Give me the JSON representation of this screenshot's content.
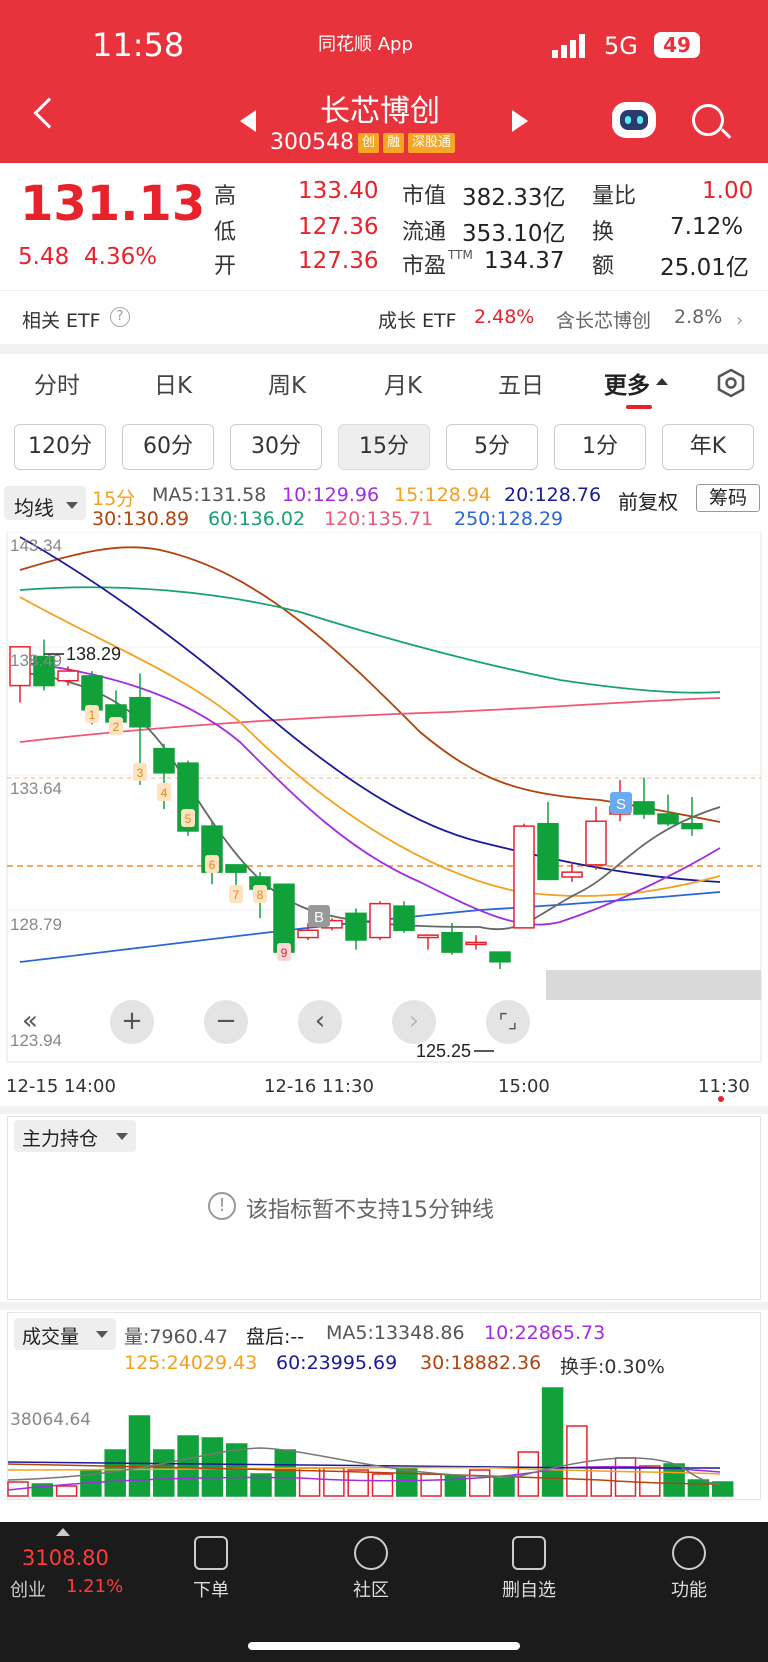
{
  "status": {
    "time": "11:58",
    "app": "同花顺 App",
    "network": "5G",
    "battery": "49"
  },
  "header": {
    "name": "长芯博创",
    "code": "300548",
    "tags": [
      "创",
      "融",
      "深股通"
    ]
  },
  "quote": {
    "price": "131.13",
    "change": "5.48",
    "pct": "4.36%",
    "high_label": "高",
    "high": "133.40",
    "low_label": "低",
    "low": "127.36",
    "open_label": "开",
    "open": "127.36",
    "mcap_label": "市值",
    "mcap": "382.33亿",
    "float_label": "流通",
    "float": "353.10亿",
    "pe_label": "市盈",
    "pe_sup": "TTM",
    "pe": "134.37",
    "volratio_label": "量比",
    "volratio": "1.00",
    "turnover_label": "换",
    "turnover": "7.12%",
    "amount_label": "额",
    "amount": "25.01亿"
  },
  "etf": {
    "label": "相关 ETF",
    "name": "成长 ETF",
    "pct": "2.48%",
    "contain": "含长芯博创",
    "weight": "2.8%"
  },
  "tabs": [
    "分时",
    "日K",
    "周K",
    "月K",
    "五日",
    "更多"
  ],
  "periods": [
    "120分",
    "60分",
    "30分",
    "15分",
    "5分",
    "1分",
    "年K"
  ],
  "ma": {
    "sel": "均线",
    "period": "15分",
    "ma5": "MA5:131.58",
    "m10": "10:129.96",
    "m15": "15:128.94",
    "m20": "20:128.76",
    "m30": "30:130.89",
    "m60": "60:136.02",
    "m120": "120:135.71",
    "m250": "250:128.29",
    "fq": "前复权",
    "chip": "筹码"
  },
  "chart": {
    "y_top": "143.34",
    "y_2": "138.49",
    "y_3": "133.64",
    "y_4": "128.79",
    "y_bot": "123.94",
    "hi": "138.29",
    "lo": "125.25",
    "x1": "12-15 14:00",
    "x2": "12-16 11:30",
    "x3": "15:00",
    "x4": "11:30",
    "marks": [
      "1",
      "2",
      "3",
      "4",
      "5",
      "6",
      "7",
      "8",
      "9"
    ],
    "b": "B",
    "s": "S"
  },
  "main_ind": {
    "sel": "主力持仓",
    "msg": "该指标暂不支持15分钟线"
  },
  "volume": {
    "sel": "成交量",
    "vol": "量:7960.47",
    "after": "盘后:--",
    "ma5": "MA5:13348.86",
    "m10": "10:22865.73",
    "m125": "125:24029.43",
    "m60": "60:23995.69",
    "m30": "30:18882.36",
    "turn": "换手:0.30%",
    "ymax": "38064.64"
  },
  "bottom": {
    "index_val": "3108.80",
    "index_name": "创业",
    "index_pct": "1.21%",
    "items": [
      "下单",
      "社区",
      "删自选",
      "功能"
    ]
  },
  "colors": {
    "up": "#e8222a",
    "down": "#11a13b",
    "brand": "#e8323c"
  }
}
